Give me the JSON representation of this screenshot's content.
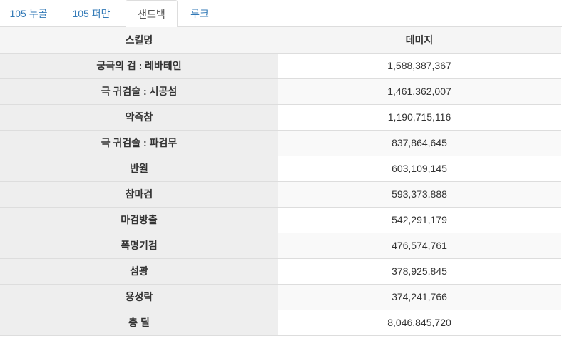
{
  "tabs": [
    {
      "label": "105 누골",
      "active": false
    },
    {
      "label": "105 퍼만",
      "active": false
    },
    {
      "label": "샌드백",
      "active": true
    },
    {
      "label": "루크",
      "active": false
    }
  ],
  "table": {
    "headers": {
      "skill": "스킬명",
      "damage": "데미지"
    },
    "rows": [
      {
        "skill": "궁극의 검 : 레바테인",
        "damage": "1,588,387,367"
      },
      {
        "skill": "극 귀검술 : 시공섬",
        "damage": "1,461,362,007"
      },
      {
        "skill": "악즉참",
        "damage": "1,190,715,116"
      },
      {
        "skill": "극 귀검술 : 파검무",
        "damage": "837,864,645"
      },
      {
        "skill": "반월",
        "damage": "603,109,145"
      },
      {
        "skill": "참마검",
        "damage": "593,373,888"
      },
      {
        "skill": "마검방출",
        "damage": "542,291,179"
      },
      {
        "skill": "폭명기검",
        "damage": "476,574,761"
      },
      {
        "skill": "섬광",
        "damage": "378,925,845"
      },
      {
        "skill": "용성락",
        "damage": "374,241,766"
      },
      {
        "skill": "총 딜",
        "damage": "8,046,845,720"
      }
    ]
  }
}
